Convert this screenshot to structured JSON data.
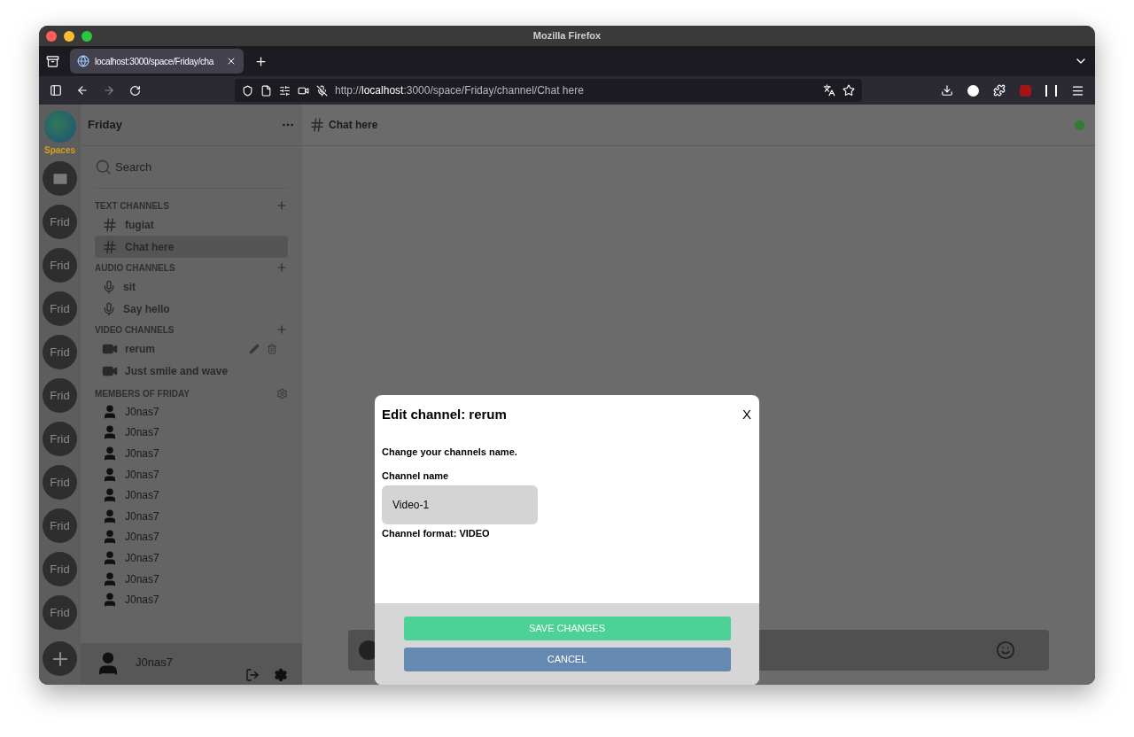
{
  "browser": {
    "window_title": "Mozilla Firefox",
    "tab_title": "localhost:3000/space/Friday/cha",
    "url": "http://**localhost**:3000/space/Friday/channel/Chat here"
  },
  "spaces": {
    "label": "Spaces",
    "items": [
      {
        "kind": "dm"
      },
      {
        "kind": "space",
        "label": "Frid"
      },
      {
        "kind": "space",
        "label": "Frid"
      },
      {
        "kind": "space",
        "label": "Frid"
      },
      {
        "kind": "space",
        "label": "Frid"
      },
      {
        "kind": "space",
        "label": "Frid"
      },
      {
        "kind": "space",
        "label": "Frid"
      },
      {
        "kind": "space",
        "label": "Frid"
      },
      {
        "kind": "space",
        "label": "Frid"
      },
      {
        "kind": "space",
        "label": "Frid"
      },
      {
        "kind": "space",
        "label": "Frid"
      },
      {
        "kind": "add"
      }
    ]
  },
  "sidebar": {
    "title": "Friday",
    "search_placeholder": "Search",
    "groups": [
      {
        "title": "TEXT CHANNELS",
        "kind": "text",
        "channels": [
          {
            "name": "fugiat",
            "selected": false,
            "actions": false
          },
          {
            "name": "Chat here",
            "selected": true,
            "actions": false
          }
        ]
      },
      {
        "title": "AUDIO CHANNELS",
        "kind": "audio",
        "channels": [
          {
            "name": "sit",
            "selected": false,
            "actions": false
          },
          {
            "name": "Say hello",
            "selected": false,
            "actions": false
          }
        ]
      },
      {
        "title": "VIDEO CHANNELS",
        "kind": "video",
        "channels": [
          {
            "name": "rerum",
            "selected": false,
            "actions": true
          },
          {
            "name": "Just smile and wave",
            "selected": false,
            "actions": false
          }
        ]
      }
    ],
    "members_title": "MEMBERS OF FRIDAY",
    "members": [
      "J0nas7",
      "J0nas7",
      "J0nas7",
      "J0nas7",
      "J0nas7",
      "J0nas7",
      "J0nas7",
      "J0nas7",
      "J0nas7",
      "J0nas7"
    ],
    "current_user": "J0nas7"
  },
  "channel_header": {
    "name": "Chat here",
    "color": "#2e7d32"
  },
  "modal": {
    "title": "Edit channel: rerum",
    "close": "X",
    "description": "Change your channels name.",
    "field_label": "Channel name",
    "field_value": "Video-1",
    "format": "Channel format: VIDEO",
    "buttons": [
      {
        "kind": "primary",
        "label": "SAVE CHANGES"
      },
      {
        "kind": "secondary",
        "label": "CANCEL"
      }
    ]
  }
}
